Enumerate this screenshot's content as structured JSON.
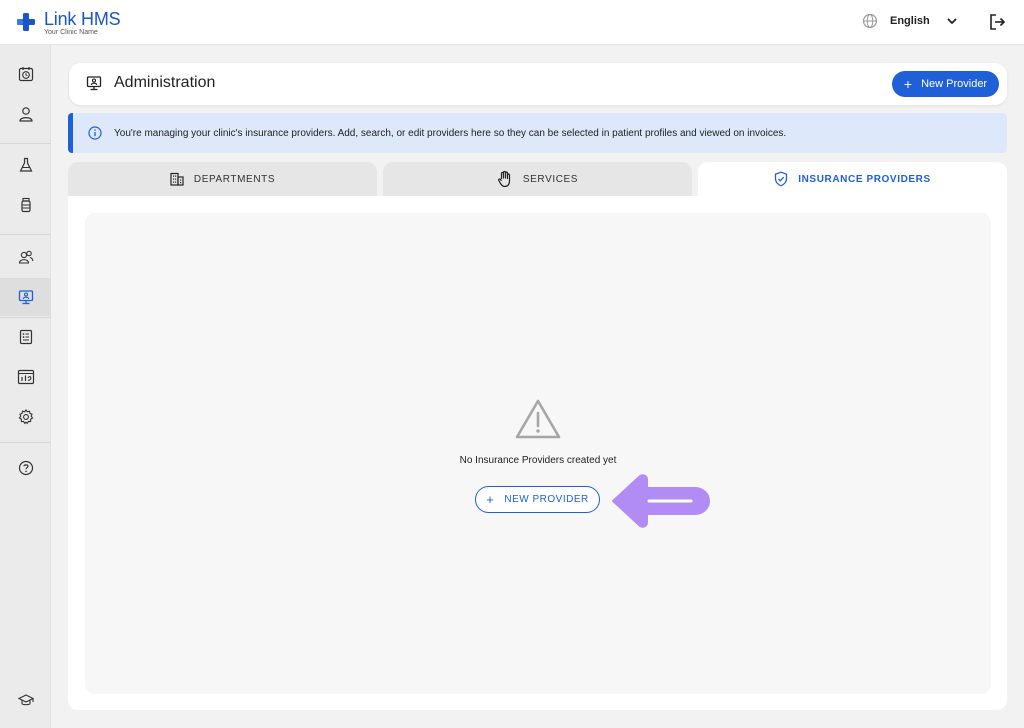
{
  "app": {
    "name": "Link HMS",
    "clinic_name": "Your Clinic Name",
    "brand_color": "#1f5fd8"
  },
  "topbar": {
    "language": "English",
    "language_icon": "globe-icon",
    "dropdown_icon": "chevron-down-icon",
    "logout_icon": "logout-icon"
  },
  "sidebar": {
    "items": [
      {
        "icon": "calendar-clock-icon"
      },
      {
        "icon": "user-icon"
      },
      {
        "icon": "flask-icon"
      },
      {
        "icon": "medicine-bottle-icon"
      },
      {
        "icon": "users-icon"
      },
      {
        "icon": "admin-monitor-icon",
        "active": true
      },
      {
        "icon": "report-icon"
      },
      {
        "icon": "analytics-icon"
      },
      {
        "icon": "settings-icon"
      },
      {
        "icon": "help-icon"
      },
      {
        "icon": "graduation-cap-icon"
      }
    ]
  },
  "header": {
    "title": "Administration",
    "new_button": "New Provider",
    "new_button_plus": "+"
  },
  "info_banner": {
    "text": "You're managing your clinic's insurance providers. Add, search, or edit providers here so they can be selected in patient profiles and viewed on invoices."
  },
  "tabs": [
    {
      "label": "DEPARTMENTS",
      "icon": "building-icon",
      "active": false
    },
    {
      "label": "SERVICES",
      "icon": "hand-icon",
      "active": false
    },
    {
      "label": "INSURANCE PROVIDERS",
      "icon": "shield-check-icon",
      "active": true
    }
  ],
  "empty_state": {
    "icon": "warning-icon",
    "message": "No Insurance Providers created yet",
    "button": "NEW PROVIDER",
    "button_plus": "+",
    "pointer_color": "#b28cf5"
  }
}
